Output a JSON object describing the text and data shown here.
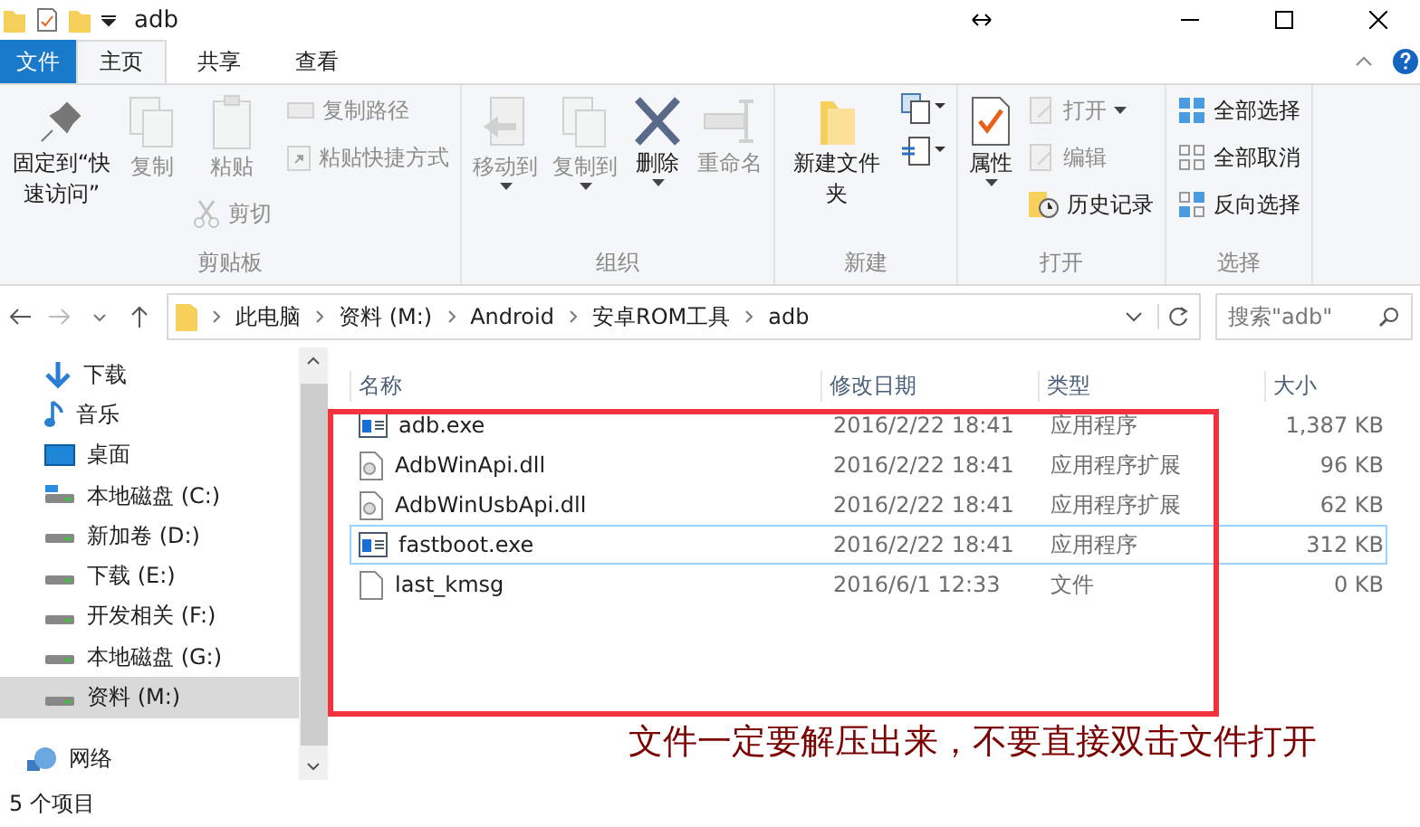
{
  "window": {
    "title": "adb"
  },
  "ribbon": {
    "tabs": [
      {
        "label": "文件",
        "kind": "file",
        "selected": false
      },
      {
        "label": "主页",
        "kind": "tab",
        "selected": true
      },
      {
        "label": "共享",
        "kind": "tab",
        "selected": false
      },
      {
        "label": "查看",
        "kind": "tab",
        "selected": false
      }
    ],
    "groups": [
      {
        "label": "剪贴板",
        "columns": [
          {
            "large": [
              {
                "label": "固定到“快速访问”",
                "kind": "pin",
                "disabled": false
              }
            ]
          },
          {
            "large": [
              {
                "label": "复制",
                "kind": "copy",
                "disabled": true
              }
            ]
          },
          {
            "large": [
              {
                "label": "粘贴",
                "kind": "paste",
                "disabled": true
              }
            ],
            "small": [
              {
                "label": "剪切",
                "kind": "cut",
                "disabled": true
              }
            ]
          },
          {
            "small": [
              {
                "label": "复制路径",
                "kind": "path",
                "disabled": true
              },
              {
                "label": "粘贴快捷方式",
                "kind": "shortcut",
                "disabled": true
              }
            ]
          }
        ]
      },
      {
        "label": "组织",
        "columns": [
          {
            "large": [
              {
                "label": "移动到",
                "kind": "move",
                "disabled": true,
                "menu": true
              }
            ]
          },
          {
            "large": [
              {
                "label": "复制到",
                "kind": "copyto",
                "disabled": true,
                "menu": true
              }
            ]
          },
          {
            "large": [
              {
                "label": "删除",
                "kind": "delete",
                "disabled": false,
                "menu": true
              }
            ]
          },
          {
            "large": [
              {
                "label": "重命名",
                "kind": "rename",
                "disabled": true
              }
            ]
          }
        ]
      },
      {
        "label": "新建",
        "columns": [
          {
            "large": [
              {
                "label": "新建文件夹",
                "kind": "folder",
                "disabled": false
              }
            ]
          },
          {
            "tools": true
          }
        ]
      },
      {
        "label": "打开",
        "columns": [
          {
            "large": [
              {
                "label": "属性",
                "kind": "props",
                "disabled": false,
                "menu": true
              }
            ]
          },
          {
            "small": [
              {
                "label": "打开",
                "kind": "open",
                "disabled": true,
                "menu": true
              },
              {
                "label": "编辑",
                "kind": "edit",
                "disabled": true
              },
              {
                "label": "历史记录",
                "kind": "history",
                "disabled": false
              }
            ]
          }
        ]
      },
      {
        "label": "选择",
        "columns": [
          {
            "small": [
              {
                "label": "全部选择",
                "kind": "selall",
                "disabled": false
              },
              {
                "label": "全部取消",
                "kind": "selnone",
                "disabled": false
              },
              {
                "label": "反向选择",
                "kind": "selinv",
                "disabled": false
              }
            ]
          }
        ]
      }
    ]
  },
  "address": {
    "crumbs": [
      "此电脑",
      "资料 (M:)",
      "Android",
      "安卓ROM工具",
      "adb"
    ],
    "search_placeholder": "搜索\"adb\""
  },
  "sidebar": {
    "items": [
      {
        "label": "下载",
        "kind": "download",
        "selected": false
      },
      {
        "label": "音乐",
        "kind": "music",
        "selected": false
      },
      {
        "label": "桌面",
        "kind": "desktop",
        "selected": false
      },
      {
        "label": "本地磁盘 (C:)",
        "kind": "system",
        "selected": false
      },
      {
        "label": "新加卷 (D:)",
        "kind": "drive",
        "selected": false
      },
      {
        "label": "下载 (E:)",
        "kind": "drive",
        "selected": false
      },
      {
        "label": "开发相关 (F:)",
        "kind": "drive",
        "selected": false
      },
      {
        "label": "本地磁盘 (G:)",
        "kind": "drive",
        "selected": false
      },
      {
        "label": "资料 (M:)",
        "kind": "drive",
        "selected": true
      },
      {
        "label": "网络",
        "kind": "network",
        "selected": false
      }
    ]
  },
  "table": {
    "columns": [
      "名称",
      "修改日期",
      "类型",
      "大小"
    ],
    "rows": [
      {
        "name": "adb.exe",
        "date": "2016/2/22 18:41",
        "type": "应用程序",
        "size": "1,387 KB",
        "kind": "exe",
        "selected": false
      },
      {
        "name": "AdbWinApi.dll",
        "date": "2016/2/22 18:41",
        "type": "应用程序扩展",
        "size": "96 KB",
        "kind": "dll",
        "selected": false
      },
      {
        "name": "AdbWinUsbApi.dll",
        "date": "2016/2/22 18:41",
        "type": "应用程序扩展",
        "size": "62 KB",
        "kind": "dll",
        "selected": false
      },
      {
        "name": "fastboot.exe",
        "date": "2016/2/22 18:41",
        "type": "应用程序",
        "size": "312 KB",
        "kind": "exe",
        "selected": true
      },
      {
        "name": "last_kmsg",
        "date": "2016/6/1 12:33",
        "type": "文件",
        "size": "0 KB",
        "kind": "file",
        "selected": false
      }
    ]
  },
  "annotation": {
    "text": "文件一定要解压出来，不要直接双击文件打开"
  },
  "status_bar": {
    "count": "5 个项目"
  }
}
